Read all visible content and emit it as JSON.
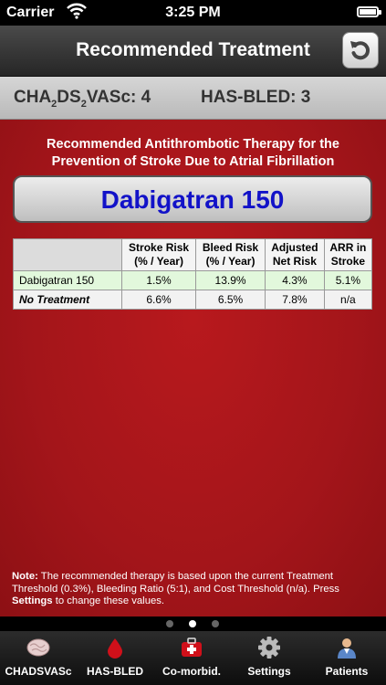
{
  "status_bar": {
    "carrier": "Carrier",
    "time": "3:25 PM"
  },
  "nav": {
    "title": "Recommended Treatment"
  },
  "scores": {
    "chadsvasc_prefix_1": "CHA",
    "chadsvasc_sub_1": "2",
    "chadsvasc_mid": "DS",
    "chadsvasc_sub_2": "2",
    "chadsvasc_suffix": "VASc: 4",
    "hasbled": "HAS-BLED: 3"
  },
  "main": {
    "heading_line1": "Recommended Antithrombotic Therapy for the",
    "heading_line2": "Prevention of Stroke Due to Atrial Fibrillation",
    "recommended_therapy": "Dabigatran 150",
    "table": {
      "headers": [
        "",
        "Stroke Risk (% / Year)",
        "Bleed Risk (% / Year)",
        "Adjusted Net Risk",
        "ARR in Stroke"
      ],
      "header_lines": [
        [
          "Stroke Risk",
          "(% / Year)"
        ],
        [
          "Bleed Risk",
          "(% / Year)"
        ],
        [
          "Adjusted",
          "Net Risk"
        ],
        [
          "ARR in",
          "Stroke"
        ]
      ],
      "rows": [
        {
          "label": "Dabigatran 150",
          "stroke": "1.5%",
          "bleed": "13.9%",
          "net": "4.3%",
          "arr": "5.1%"
        },
        {
          "label": "No Treatment",
          "stroke": "6.6%",
          "bleed": "6.5%",
          "net": "7.8%",
          "arr": "n/a"
        }
      ]
    },
    "note": {
      "label": "Note:",
      "text": " The recommended therapy is based upon the current Treatment Threshold (0.3%), Bleeding Ratio (5:1), and Cost Threshold (n/a). Press ",
      "settings_word": "Settings",
      "tail": " to change these values."
    }
  },
  "page_indicator": {
    "count": 3,
    "active_index": 1
  },
  "tabs": [
    {
      "label": "CHADSVASc",
      "icon": "brain-icon"
    },
    {
      "label": "HAS-BLED",
      "icon": "blood-drop-icon"
    },
    {
      "label": "Co-morbid.",
      "icon": "first-aid-kit-icon"
    },
    {
      "label": "Settings",
      "icon": "gear-icon"
    },
    {
      "label": "Patients",
      "icon": "patient-icon"
    }
  ],
  "colors": {
    "accent_red": "#a3151a",
    "therapy_blue": "#1212c8",
    "recommended_row": "#e2f8dc"
  }
}
